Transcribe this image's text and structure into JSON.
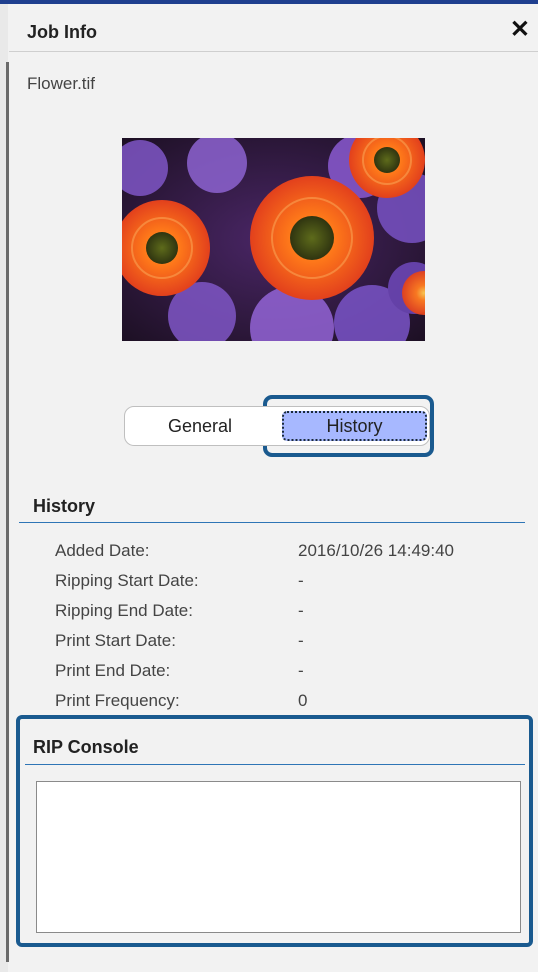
{
  "window": {
    "title": "Job Info",
    "close_glyph": "✕"
  },
  "job": {
    "filename": "Flower.tif"
  },
  "tabs": [
    {
      "label": "General",
      "selected": false
    },
    {
      "label": "History",
      "selected": true
    }
  ],
  "history": {
    "heading": "History",
    "rows": [
      {
        "label": "Added Date:",
        "value": "2016/10/26 14:49:40"
      },
      {
        "label": "Ripping Start Date:",
        "value": "-"
      },
      {
        "label": "Ripping End Date:",
        "value": "-"
      },
      {
        "label": "Print Start Date:",
        "value": "-"
      },
      {
        "label": "Print End Date:",
        "value": "-"
      },
      {
        "label": "Print Frequency:",
        "value": "0"
      }
    ]
  },
  "console": {
    "heading": "RIP Console",
    "content": ""
  },
  "colors": {
    "accent_blue": "#2e75b6",
    "focus_ring": "#1a5a8f",
    "selected_tab": "#a7b8ff",
    "top_strip": "#1f3f8f"
  }
}
